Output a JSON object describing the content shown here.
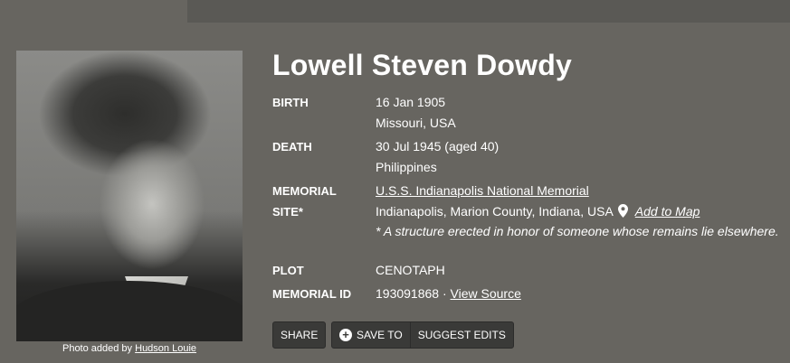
{
  "memorial": {
    "name": "Lowell Steven Dowdy",
    "photo_credit_prefix": "Photo added by",
    "photo_credit_user": "Hudson Louie"
  },
  "details": {
    "birth_label": "BIRTH",
    "birth_date": "16 Jan 1905",
    "birth_place": "Missouri, USA",
    "death_label": "DEATH",
    "death_date": "30 Jul 1945 (aged 40)",
    "death_place": "Philippines",
    "site_label_line1": "MEMORIAL",
    "site_label_line2": "SITE*",
    "site_name": "U.S.S. Indianapolis National Memorial",
    "site_location": "Indianapolis, Marion County, Indiana, USA",
    "add_to_map": "Add to Map",
    "site_note": "* A structure erected in honor of someone whose remains lie elsewhere.",
    "plot_label": "PLOT",
    "plot_value": "CENOTAPH",
    "memorial_id_label": "MEMORIAL ID",
    "memorial_id": "193091868",
    "id_separator": "·",
    "view_source": "View Source"
  },
  "actions": {
    "share": "SHARE",
    "save_to": "SAVE TO",
    "suggest_edits": "SUGGEST EDITS"
  },
  "icons": {
    "pin": "map-pin-icon",
    "plus": "plus-circle-icon"
  },
  "colors": {
    "background": "#676560",
    "button_bg": "#3a3a38",
    "text": "#ffffff"
  }
}
